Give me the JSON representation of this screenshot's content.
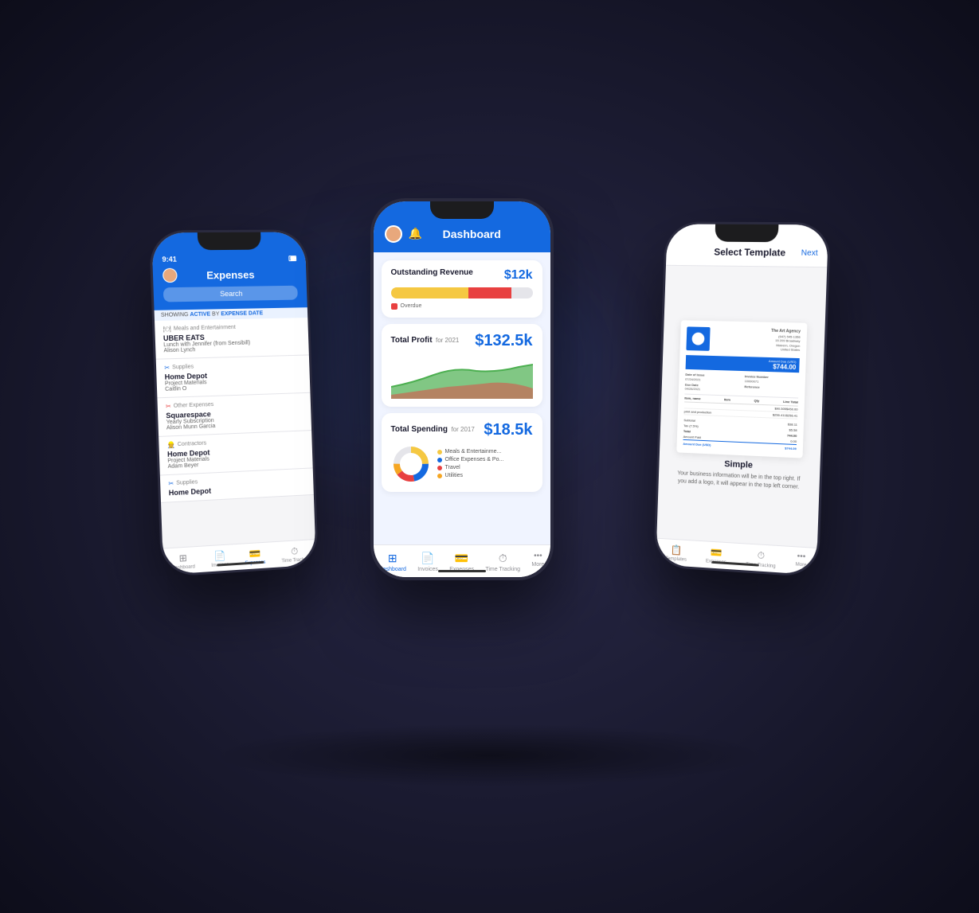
{
  "left_phone": {
    "status_time": "9:41",
    "header_title": "Expenses",
    "search_placeholder": "Search",
    "filter_text": "SHOWING ACTIVE BY EXPENSE DATE",
    "expenses": [
      {
        "category": "Meals and Entertainment",
        "category_icon": "🍽",
        "name": "UBER EATS",
        "detail1": "Lunch with Jennifer (from Sensibill)",
        "detail2": "Alison Lynch"
      },
      {
        "category": "Supplies",
        "category_icon": "✂",
        "name": "Home Depot",
        "detail1": "Project Materials",
        "detail2": "Caitlin O"
      },
      {
        "category": "Other Expenses",
        "category_icon": "✂",
        "name": "Squarespace",
        "detail1": "Yearly Subscription",
        "detail2": "Alison Munn Garcia"
      },
      {
        "category": "Contractors",
        "category_icon": "👷",
        "name": "Home Depot",
        "detail1": "Project Materials",
        "detail2": "Adam Beyer"
      },
      {
        "category": "Supplies",
        "category_icon": "✂",
        "name": "Home Depot",
        "detail1": "",
        "detail2": ""
      }
    ],
    "nav_items": [
      {
        "label": "Dashboard",
        "icon": "⊞",
        "active": false
      },
      {
        "label": "Invoices",
        "icon": "📄",
        "active": false
      },
      {
        "label": "Expenses",
        "icon": "💳",
        "active": true
      },
      {
        "label": "Time Track...",
        "icon": "⏱",
        "active": false
      }
    ]
  },
  "center_phone": {
    "header_title": "Dashboard",
    "outstanding_revenue_label": "Outstanding Revenue",
    "outstanding_revenue_value": "$12k",
    "overdue_label": "Overdue",
    "total_profit_label": "Total Profit",
    "total_profit_year": "for 2021",
    "total_profit_value": "$132.5k",
    "total_spending_label": "Total Spending",
    "total_spending_year": "for 2017",
    "total_spending_value": "$18.5k",
    "spending_categories": [
      {
        "label": "Meals & Entertainme...",
        "color": "#f5c842"
      },
      {
        "label": "Office Expenses & Po...",
        "color": "#1469e0"
      },
      {
        "label": "Travel",
        "color": "#e84040"
      },
      {
        "label": "Utilities",
        "color": "#f5a623"
      }
    ],
    "nav_items": [
      {
        "label": "Dashboard",
        "icon": "⊞",
        "active": true
      },
      {
        "label": "Invoices",
        "icon": "📄",
        "active": false
      },
      {
        "label": "Expenses",
        "icon": "💳",
        "active": false
      },
      {
        "label": "Time Tracking",
        "icon": "⏱",
        "active": false
      },
      {
        "label": "More",
        "icon": "•••",
        "active": false
      }
    ]
  },
  "right_phone": {
    "header_title": "Select Template",
    "next_label": "Next",
    "invoice_company_name": "The Art Agency",
    "invoice_company_phone": "(647) 545-1356",
    "invoice_company_address": "15 209 Broadway\nMalvern, Oregon\n12003\nUnited States",
    "invoice_number_label": "Invoice Number",
    "invoice_number": "10000071",
    "invoice_date_label": "Date of Issue",
    "invoice_date": "07/24/2021",
    "invoice_due_label": "Due Date",
    "invoice_due": "04/28/2021",
    "invoice_ref_label": "Reference",
    "invoice_amount_label": "Amount Due (USD)",
    "invoice_amount": "$744.00",
    "template_name": "Simple",
    "template_desc": "Your business information will be in the top right. If you add a logo, it will appear in the top left corner.",
    "nav_items": [
      {
        "label": "Templates",
        "icon": "📋"
      },
      {
        "label": "Expenses",
        "icon": "💳"
      },
      {
        "label": "Time Tracking",
        "icon": "⏱"
      },
      {
        "label": "More",
        "icon": "•••"
      }
    ]
  }
}
